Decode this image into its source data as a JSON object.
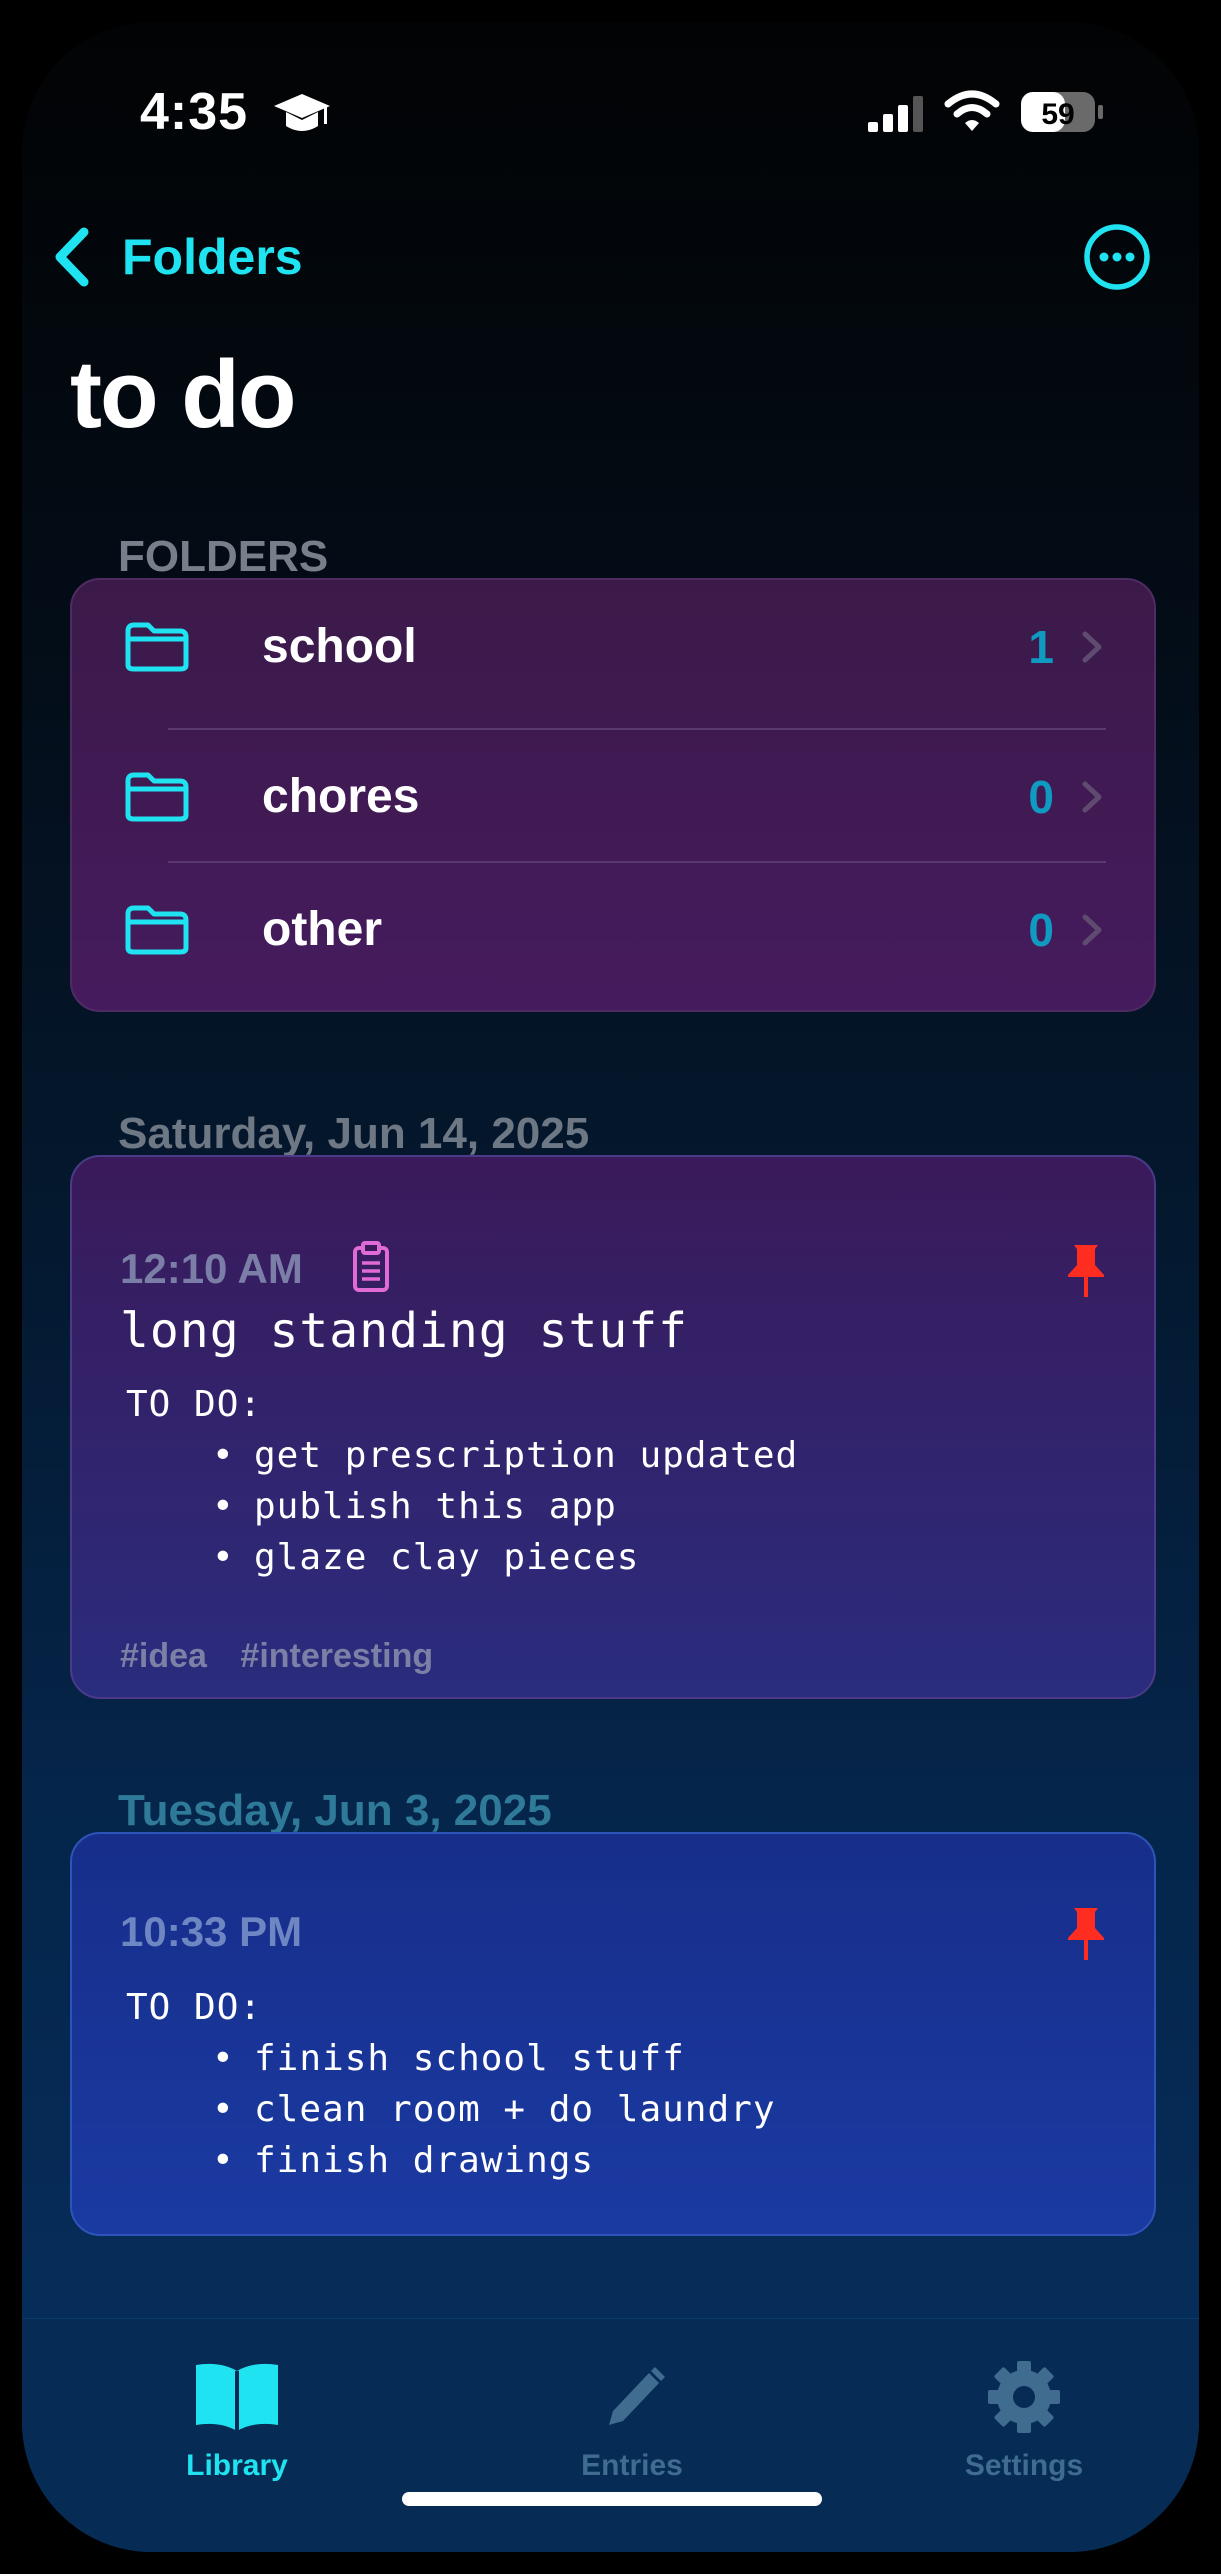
{
  "status_bar": {
    "time": "4:35",
    "battery": "59"
  },
  "nav": {
    "back_label": "Folders",
    "title": "to do"
  },
  "folders_section": {
    "header": "FOLDERS",
    "items": [
      {
        "label": "school",
        "count": "1"
      },
      {
        "label": "chores",
        "count": "0"
      },
      {
        "label": "other",
        "count": "0"
      }
    ]
  },
  "entries": [
    {
      "date": "Saturday, Jun 14, 2025",
      "time": "12:10 AM",
      "title": "long standing stuff",
      "heading": "TO DO:",
      "items": [
        "get prescription updated",
        "publish this app",
        "glaze clay pieces"
      ],
      "tags": [
        "#idea",
        "#interesting"
      ],
      "pinned": true
    },
    {
      "date": "Tuesday, Jun 3, 2025",
      "time": "10:33 PM",
      "heading": "TO DO:",
      "items": [
        "finish school stuff",
        "clean room + do laundry",
        "finish drawings"
      ],
      "pinned": true
    }
  ],
  "tabbar": {
    "library": "Library",
    "entries": "Entries",
    "settings": "Settings"
  },
  "colors": {
    "accent": "#1fe3f0",
    "pin": "#ff2d20",
    "count": "#0e9ac1"
  },
  "icons": [
    "graduation-cap-icon",
    "signal-icon",
    "wifi-icon",
    "battery-icon",
    "chevron-left-icon",
    "ellipsis-circle-icon",
    "folder-icon",
    "chevron-right-icon",
    "clipboard-icon",
    "pin-icon",
    "book-icon",
    "pencil-icon",
    "gear-icon"
  ]
}
